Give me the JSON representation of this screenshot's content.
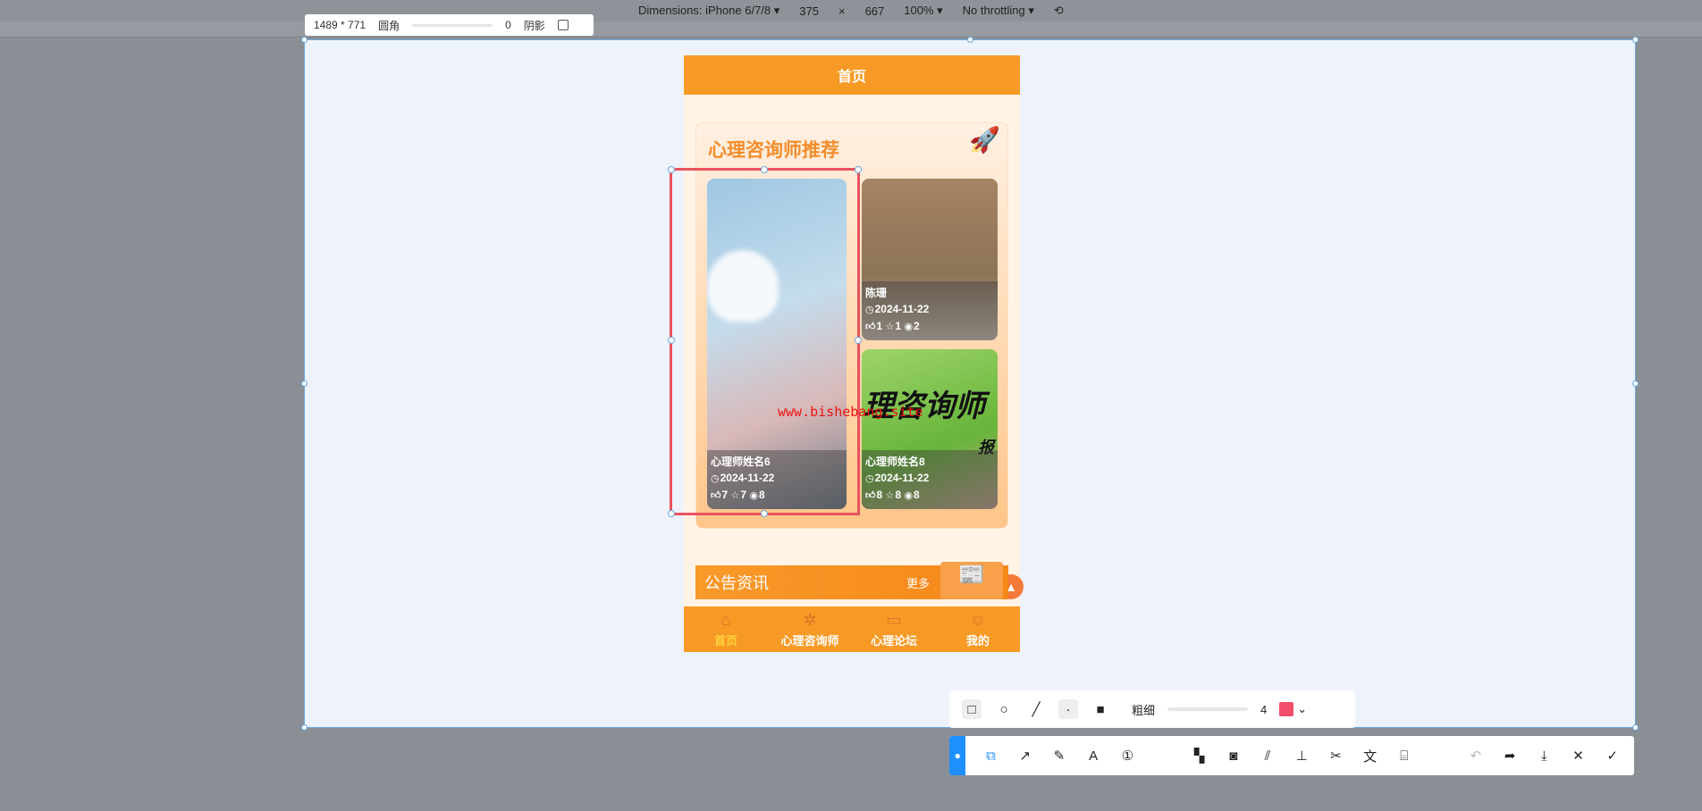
{
  "devtools": {
    "dimensions": "Dimensions: iPhone 6/7/8 ▾",
    "width": "375",
    "x": "×",
    "height": "667",
    "zoom": "100% ▾",
    "throttle": "No throttling ▾"
  },
  "size_tooltip": {
    "size": "1489 * 771",
    "radius_label": "圆角",
    "radius_value": "0",
    "shadow_label": "阴影"
  },
  "app": {
    "header_title": "首页",
    "recommend": {
      "title": "心理咨询师推荐",
      "cards": [
        {
          "name": "心理师姓名6",
          "date": "2024-11-22",
          "likes": "7",
          "favorites": "7",
          "views": "8"
        },
        {
          "name": "陈珊",
          "date": "2024-11-22",
          "likes": "1",
          "favorites": "1",
          "views": "2"
        },
        {
          "name": "心理师姓名8",
          "date": "2024-11-22",
          "likes": "8",
          "favorites": "8",
          "views": "8",
          "image_text": "理咨询师",
          "image_text2": "报"
        }
      ]
    },
    "notice": {
      "title": "公告资讯",
      "more": "更多"
    },
    "nav": [
      {
        "label": "首页",
        "icon": "home-icon",
        "active": true
      },
      {
        "label": "心理咨询师",
        "icon": "counselor-icon"
      },
      {
        "label": "心理论坛",
        "icon": "forum-icon"
      },
      {
        "label": "我的",
        "icon": "user-icon"
      }
    ]
  },
  "watermark": "www.bishebang.site",
  "annot_toolbar": {
    "thickness_label": "粗细",
    "thickness_value": "4",
    "color": "#f24d6b"
  },
  "colors": {
    "brand": "#f79a25",
    "selection": "#6aa7de",
    "rect": "#e8535e"
  }
}
